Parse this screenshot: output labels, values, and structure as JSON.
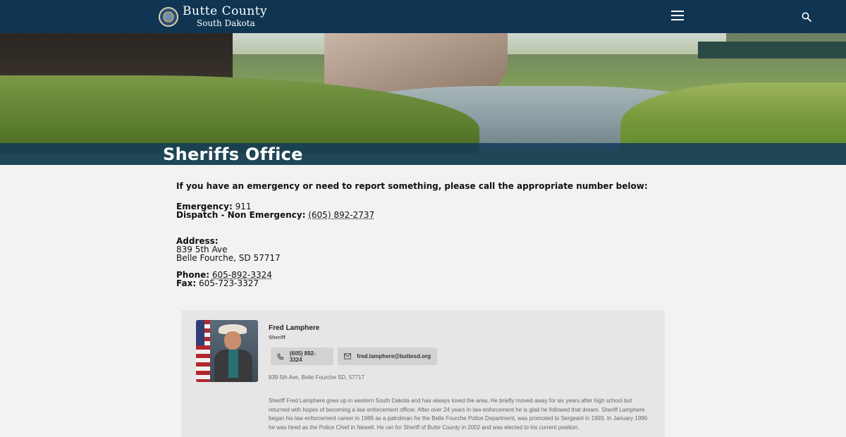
{
  "header": {
    "logo_line1": "Butte County",
    "logo_line2": "South Dakota",
    "menu_icon": "hamburger-menu-icon",
    "search_icon": "search-icon",
    "background_color": "#0f3552"
  },
  "page": {
    "title": "Sheriffs Office"
  },
  "contact": {
    "intro": "If you have an emergency or need to report something, please call the appropriate number below:",
    "emergency_label": "Emergency:",
    "emergency_value": "911",
    "dispatch_label": "Dispatch - Non Emergency:",
    "dispatch_value": "(605) 892-2737",
    "address_label": "Address:",
    "address_line1": "839 5th Ave",
    "address_line2": "Belle Fourche, SD 57717",
    "phone_label": "Phone:",
    "phone_value": "605-892-3324",
    "fax_label": "Fax:",
    "fax_value": "605-723-3327"
  },
  "staff": {
    "name": "Fred Lamphere",
    "role": "Sheriff",
    "phone": "(605) 892-3324",
    "email": "fred.lamphere@buttesd.org",
    "address": "839 5th Ave, Belle Fourche SD, 57717",
    "bio": "Sheriff Fred Lamphere grew up in western South Dakota and has always loved the area.  He briefly moved away for six years after high school but returned with hopes of becoming a law enforcement officer.  After over 24 years in law enforcement he is glad he followed that dream.  Sheriff Lamphere began his law enforcement career in 1989 as a patrolman for the Belle Fourche Police Department, was promoted to Sergeant in 1993.  In January 1996 he was hired as the Police Chief in Newell.  He ran for Sheriff of Butte County in 2002 and was elected to his current position."
  }
}
